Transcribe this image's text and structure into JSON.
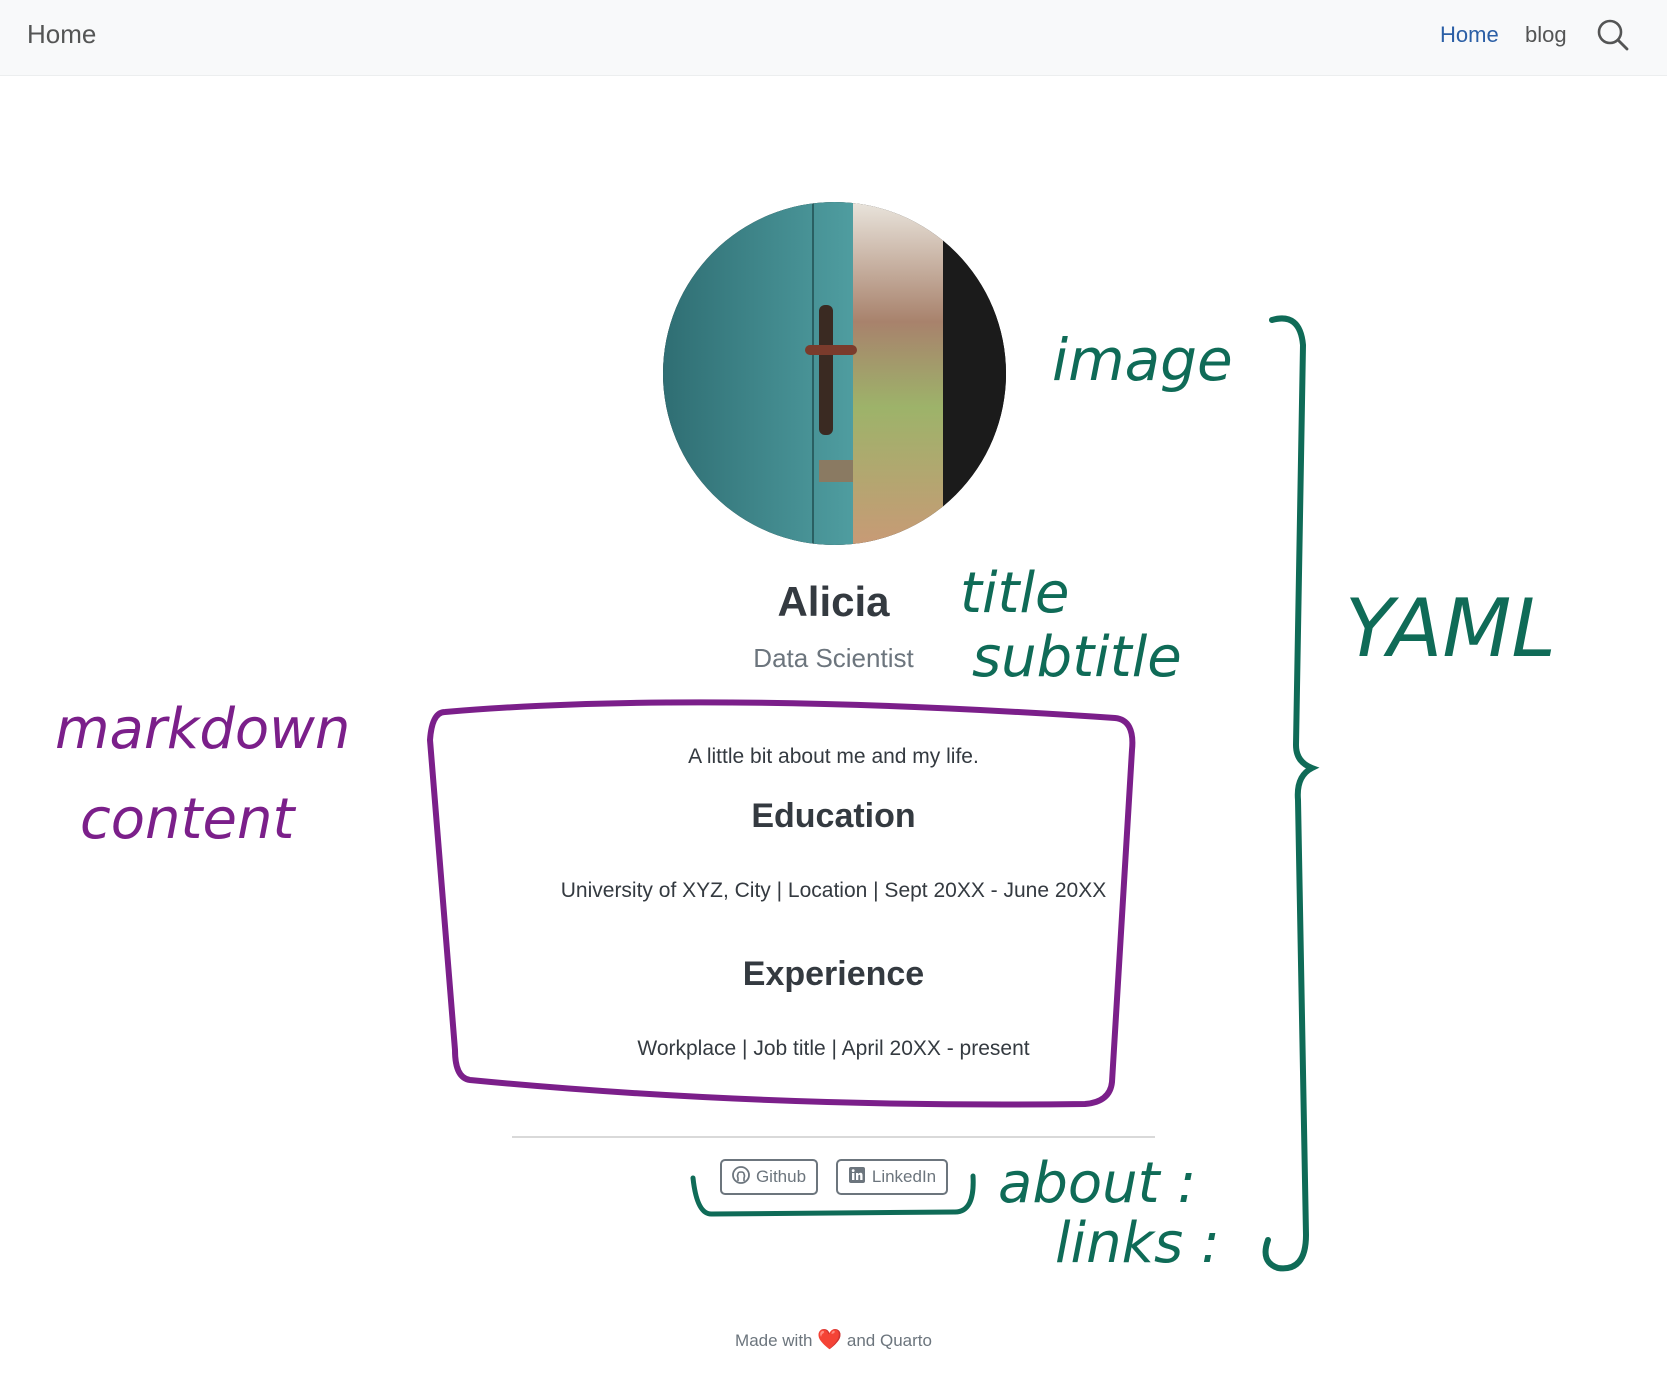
{
  "navbar": {
    "brand": "Home",
    "links": [
      {
        "label": "Home",
        "active": true
      },
      {
        "label": "blog",
        "active": false
      }
    ],
    "search_icon": "search-icon"
  },
  "profile": {
    "image_icon": "door-photo",
    "title": "Alicia",
    "subtitle": "Data Scientist"
  },
  "content": {
    "intro": "A little bit about me and my life.",
    "education_heading": "Education",
    "education_text": "University of XYZ, City | Location | Sept 20XX - June 20XX",
    "experience_heading": "Experience",
    "experience_text": "Workplace | Job title | April 20XX - present"
  },
  "links": [
    {
      "label": "Github",
      "icon": "github-icon"
    },
    {
      "label": "LinkedIn",
      "icon": "linkedin-icon"
    }
  ],
  "footer": {
    "before": "Made with",
    "heart": "❤️",
    "after": "and Quarto"
  },
  "annotations": {
    "image": "image",
    "title": "title",
    "subtitle": "subtitle",
    "yaml": "YAML",
    "markdown": "markdown",
    "content": "content",
    "about": "about :",
    "links": "links :",
    "colors": {
      "green": "#0f6b57",
      "purple": "#7b1f8a"
    }
  }
}
